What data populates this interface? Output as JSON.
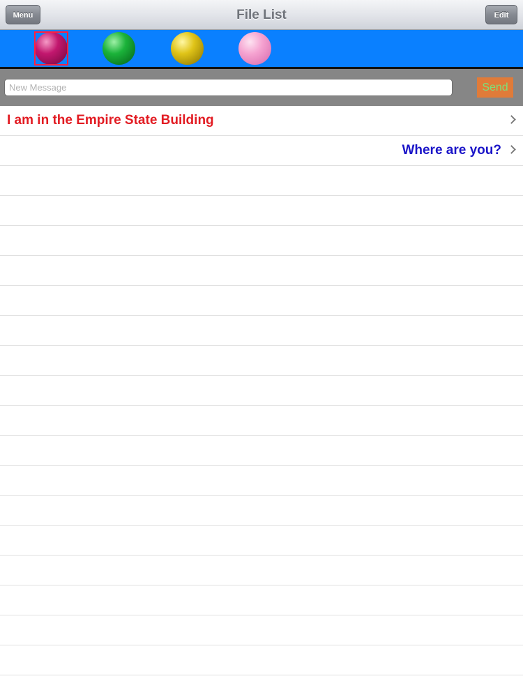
{
  "navbar": {
    "title": "File List",
    "menu_label": "Menu",
    "edit_label": "Edit"
  },
  "color_picker": {
    "colors": [
      {
        "name": "magenta",
        "hex": "#c2176e",
        "selected": true
      },
      {
        "name": "green",
        "hex": "#1bb33a",
        "selected": false
      },
      {
        "name": "yellow",
        "hex": "#e0c418",
        "selected": false
      },
      {
        "name": "pink",
        "hex": "#f5a2d0",
        "selected": false
      }
    ],
    "bar_color": "#0a80ff",
    "selection_color": "#ff2040"
  },
  "composer": {
    "placeholder": "New Message",
    "value": "",
    "send_label": "Send"
  },
  "messages": [
    {
      "text": "I am in the Empire State Building",
      "align": "left",
      "color": "#e21b22"
    },
    {
      "text": "Where are you?",
      "align": "right",
      "color": "#1a14c8"
    }
  ],
  "chevron_icon": "chevron-right-icon"
}
